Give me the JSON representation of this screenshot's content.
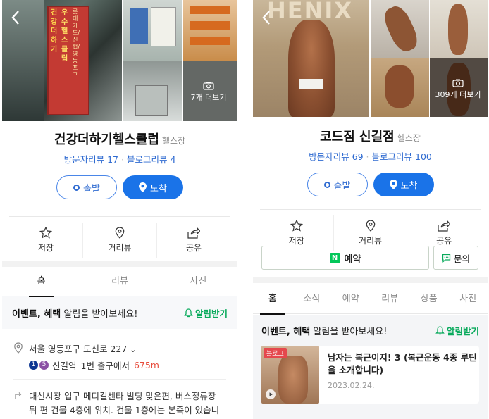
{
  "left": {
    "photos": {
      "more_label": "7개 더보기"
    },
    "title": "건강더하기헬스클럽",
    "category": "헬스장",
    "visitor_reviews": "방문자리뷰 17",
    "blog_reviews": "블로그리뷰 4",
    "depart_label": "출발",
    "arrive_label": "도착",
    "actions": {
      "save": "저장",
      "street": "거리뷰",
      "share": "공유"
    },
    "tabs": [
      "홈",
      "리뷰",
      "사진"
    ],
    "event_text_bold": "이벤트, 혜택",
    "event_text": " 알림을 받아보세요!",
    "alarm_label": "알림받기",
    "address": "서울 영등포구 도신로 227",
    "subway": {
      "line1": "1",
      "line2": "5",
      "station": "신길역",
      "exit": "1번 출구에서",
      "distance": "675m"
    },
    "directions": "대신시장 입구 메디컬센타 빌딩 맞은편, 버스정류장 뒤 편 건물 4층에 위치. 건물 1층에는 본죽이 있습니다.",
    "sign_text_1": "건강더하기",
    "sign_text_2": "우수헬스클럽",
    "sign_text_3": "롯데카드/신협/영등포구"
  },
  "right": {
    "photos": {
      "more_label": "309개 더보기",
      "banner_text": "HENIX"
    },
    "title": "코드짐 신길점",
    "category": "헬스장",
    "visitor_reviews": "방문자리뷰 69",
    "blog_reviews": "블로그리뷰 100",
    "depart_label": "출발",
    "arrive_label": "도착",
    "actions": {
      "save": "저장",
      "street": "거리뷰",
      "share": "공유"
    },
    "reserve_label": "예약",
    "inquiry_label": "문의",
    "tabs": [
      "홈",
      "소식",
      "예약",
      "리뷰",
      "상품",
      "사진"
    ],
    "event_text_bold": "이벤트, 혜택",
    "event_text": " 알림을 받아보세요!",
    "alarm_label": "알림받기",
    "blog": {
      "badge": "블로그",
      "title": "남자는 복근이지! 3 (복근운동 4종 루틴을 소개합니다)",
      "date": "2023.02.24."
    }
  },
  "colors": {
    "accent_blue": "#1a73e8",
    "naver_green": "#03c75a",
    "alarm_green": "#09aa5c",
    "distance_red": "#e74c3c"
  }
}
